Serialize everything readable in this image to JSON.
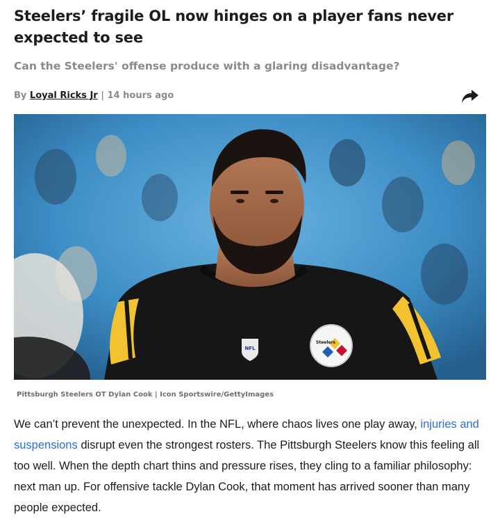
{
  "article": {
    "headline": "Steelers’ fragile OL now hinges on a player fans never expected to see",
    "subheadline": "Can the Steelers' offense produce with a glaring disadvantage?",
    "byline_prefix": "By",
    "author": "Loyal Ricks Jr",
    "separator": " | ",
    "timestamp": "14 hours ago",
    "share_icon": "share-arrow-icon",
    "image_caption": "Pittsburgh Steelers OT Dylan Cook | Icon Sportswire/GettyImages",
    "image_logo_text": "Steelers",
    "body": {
      "part1": "We can’t prevent the unexpected. In the NFL, where chaos lives one play away, ",
      "link_text": "injuries and suspensions",
      "part2": " disrupt even the strongest rosters. The Pittsburgh Steelers know this feeling all too well. When the depth chart thins and pressure rises, they cling to a familiar philosophy: next man up. For offensive tackle Dylan Cook, that moment has arrived sooner than many people expected."
    }
  },
  "colors": {
    "headline": "#1c1c1c",
    "subhead": "#8a8a8a",
    "link": "#2a6fd6",
    "jersey_gold": "#f2c230",
    "jersey_black": "#161616",
    "stadium_blue": "#3d8dc6"
  }
}
